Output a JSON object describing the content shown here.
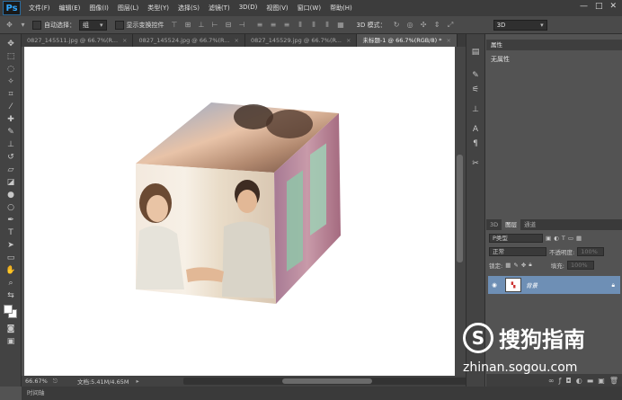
{
  "app": {
    "logo": "Ps",
    "window_controls": [
      "—",
      "□",
      "✕"
    ]
  },
  "menu": [
    "文件(F)",
    "编辑(E)",
    "图像(I)",
    "图层(L)",
    "类型(Y)",
    "选择(S)",
    "滤镜(T)",
    "3D(D)",
    "视图(V)",
    "窗口(W)",
    "帮助(H)"
  ],
  "options": {
    "auto_select_label": "自动选择：",
    "auto_select_value": "组",
    "show_transform_label": "显示变换控件",
    "mode_label": "3D 模式：",
    "workspace_value": "3D"
  },
  "tabs": [
    {
      "label": "0827_145511.jpg @ 66.7%(R...",
      "active": false
    },
    {
      "label": "0827_145524.jpg @ 66.7%(R...",
      "active": false
    },
    {
      "label": "0827_145529.jpg @ 66.7%(R...",
      "active": false
    },
    {
      "label": "未标题-1 @ 66.7%(RGB/8) *",
      "active": true
    }
  ],
  "tab_close": "×",
  "status": {
    "zoom": "66.67%",
    "doc_info": "文档:5.41M/4.65M"
  },
  "timeline_label": "时间轴",
  "properties": {
    "title": "属性",
    "content": "无属性"
  },
  "layers": {
    "tabs": [
      "3D",
      "图层",
      "通道"
    ],
    "filter": "P类型",
    "blend_mode": "正常",
    "opacity_label": "不透明度:",
    "opacity": "100%",
    "lock_label": "锁定:",
    "fill_label": "填充:",
    "fill": "100%",
    "layer_name": "背景"
  },
  "watermark": {
    "brand": "搜狗指南",
    "url": "zhinan.sogou.com"
  },
  "colors": {
    "menubar": "#3c3c3c",
    "canvas_bg": "#535353",
    "layer_selected": "#6e8fb5",
    "ps_blue": "#31a8ff"
  }
}
